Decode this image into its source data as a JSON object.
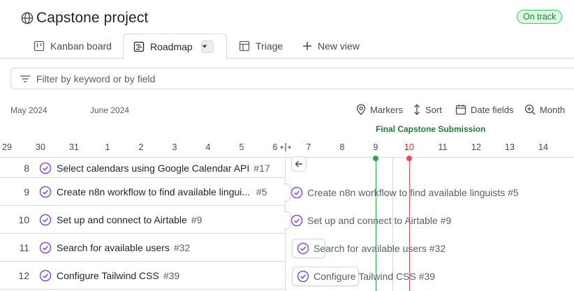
{
  "header": {
    "title": "Capstone project",
    "status_badge": "On track",
    "globe_icon": "globe-icon"
  },
  "tabs": [
    {
      "label": "Kanban board",
      "icon": "kanban-icon"
    },
    {
      "label": "Roadmap",
      "icon": "roadmap-icon",
      "active": true
    },
    {
      "label": "Triage",
      "icon": "table-icon"
    },
    {
      "label": "New view",
      "icon": "plus-icon"
    }
  ],
  "filter": {
    "placeholder": "Filter by keyword or by field",
    "value": ""
  },
  "timeline": {
    "months": [
      "May 2024",
      "June 2024"
    ],
    "toolbar": {
      "markers": "Markers",
      "sort": "Sort",
      "date_fields": "Date fields",
      "zoom": "Month"
    },
    "marker_label": "Final Capstone Submission",
    "days": [
      "29",
      "30",
      "31",
      "1",
      "2",
      "3",
      "4",
      "5",
      "6",
      "7",
      "8",
      "9",
      "10",
      "11",
      "12",
      "13",
      "14"
    ],
    "today": "10",
    "marker_day": "9"
  },
  "rows": [
    {
      "num": "8",
      "title": "Select calendars using Google Calendar API",
      "ref": "#17"
    },
    {
      "num": "9",
      "title": "Create n8n workflow to find available lingui...",
      "ref": "#5"
    },
    {
      "num": "10",
      "title": "Set up and connect to Airtable",
      "ref": "#9"
    },
    {
      "num": "11",
      "title": "Search for available users",
      "ref": "#32"
    },
    {
      "num": "12",
      "title": "Configure Tailwind CSS",
      "ref": "#39"
    }
  ],
  "timeline_items": [
    {
      "label": "Create n8n workflow to find available linguists #5"
    },
    {
      "label": "Set up and connect to Airtable #9"
    },
    {
      "label": "Search for available users #32"
    },
    {
      "label": "Configure Tailwind CSS #39"
    }
  ],
  "colors": {
    "accent_purple": "#8250df",
    "marker_green": "#2da44e",
    "today_red": "#e5534b",
    "border": "#d0d7de"
  }
}
